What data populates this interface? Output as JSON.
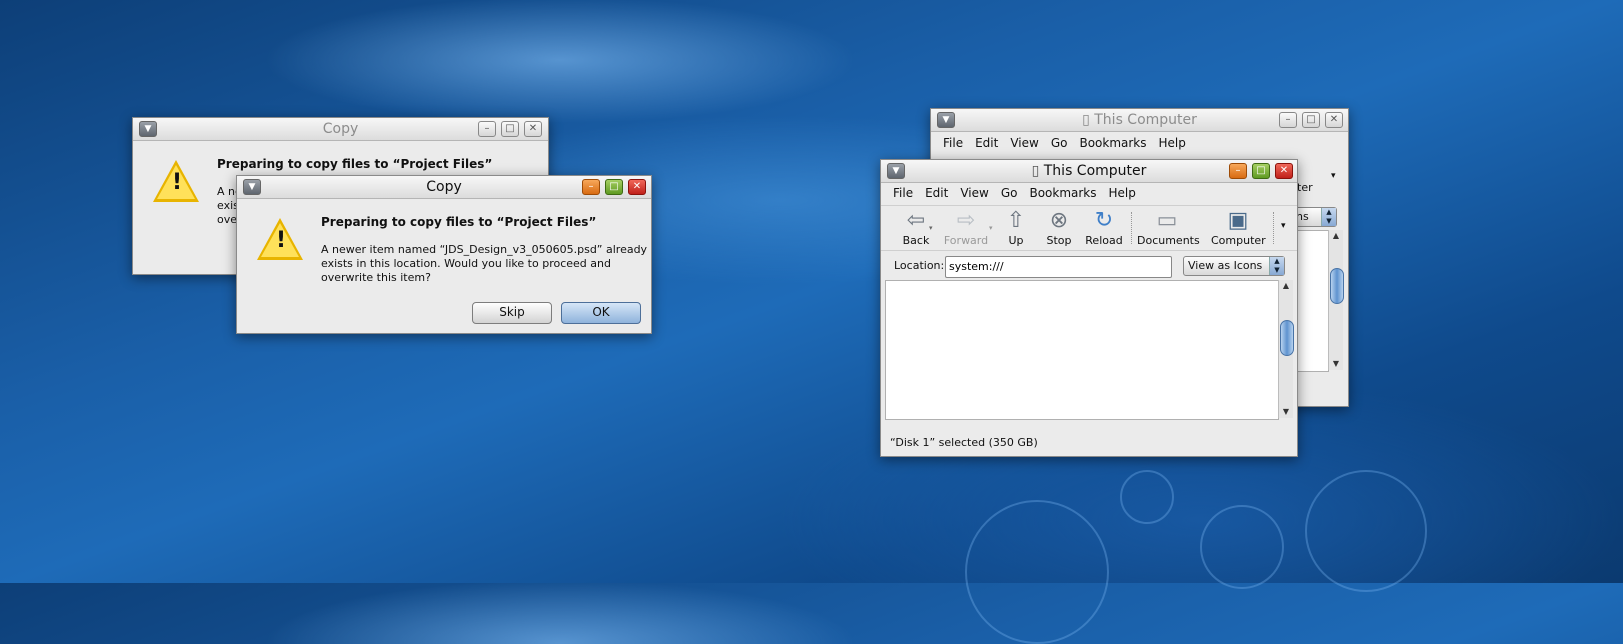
{
  "dialog_back": {
    "title": "Copy",
    "heading": "Preparing to copy files to “Project Files”",
    "body_lines": [
      "A ne",
      "exis",
      "ove"
    ]
  },
  "dialog_front": {
    "title": "Copy",
    "heading": "Preparing to copy files to “Project Files”",
    "body_lines": [
      "A newer item named “JDS_Design_v3_050605.psd” already",
      "exists in this location.  Would you like to proceed and",
      "overwrite this item?"
    ],
    "skip_label": "Skip",
    "ok_label": "OK"
  },
  "browser_back": {
    "title": "This Computer",
    "menus": [
      "File",
      "Edit",
      "View",
      "Go",
      "Bookmarks",
      "Help"
    ],
    "toolbar_fragment": "ter",
    "combo_fragment": "ns"
  },
  "browser_front": {
    "title": "This Computer",
    "menus": [
      "File",
      "Edit",
      "View",
      "Go",
      "Bookmarks",
      "Help"
    ],
    "toolbar": {
      "back": "Back",
      "forward": "Forward",
      "up": "Up",
      "stop": "Stop",
      "reload": "Reload",
      "documents": "Documents",
      "computer": "Computer"
    },
    "location_label": "Location:",
    "location_value": "system:///",
    "view_mode": "View as Icons",
    "status": "“Disk 1” selected (350 GB)"
  }
}
